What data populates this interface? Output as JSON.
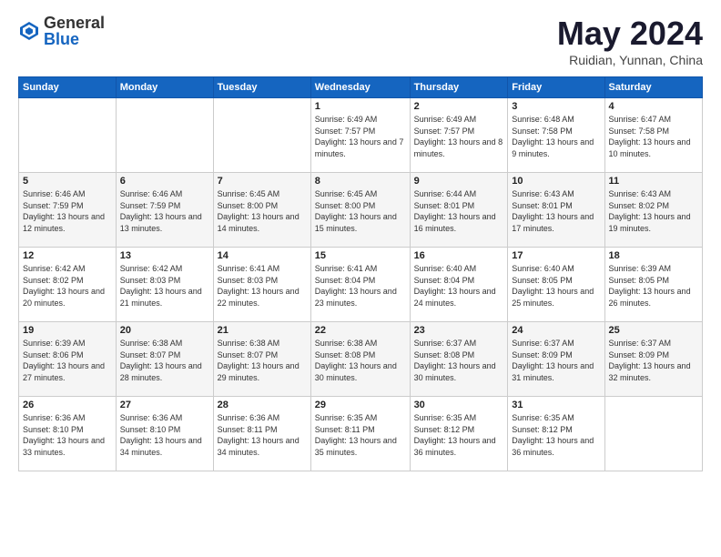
{
  "header": {
    "logo_general": "General",
    "logo_blue": "Blue",
    "month_title": "May 2024",
    "location": "Ruidian, Yunnan, China"
  },
  "weekdays": [
    "Sunday",
    "Monday",
    "Tuesday",
    "Wednesday",
    "Thursday",
    "Friday",
    "Saturday"
  ],
  "weeks": [
    [
      {
        "day": "",
        "sunrise": "",
        "sunset": "",
        "daylight": ""
      },
      {
        "day": "",
        "sunrise": "",
        "sunset": "",
        "daylight": ""
      },
      {
        "day": "",
        "sunrise": "",
        "sunset": "",
        "daylight": ""
      },
      {
        "day": "1",
        "sunrise": "Sunrise: 6:49 AM",
        "sunset": "Sunset: 7:57 PM",
        "daylight": "Daylight: 13 hours and 7 minutes."
      },
      {
        "day": "2",
        "sunrise": "Sunrise: 6:49 AM",
        "sunset": "Sunset: 7:57 PM",
        "daylight": "Daylight: 13 hours and 8 minutes."
      },
      {
        "day": "3",
        "sunrise": "Sunrise: 6:48 AM",
        "sunset": "Sunset: 7:58 PM",
        "daylight": "Daylight: 13 hours and 9 minutes."
      },
      {
        "day": "4",
        "sunrise": "Sunrise: 6:47 AM",
        "sunset": "Sunset: 7:58 PM",
        "daylight": "Daylight: 13 hours and 10 minutes."
      }
    ],
    [
      {
        "day": "5",
        "sunrise": "Sunrise: 6:46 AM",
        "sunset": "Sunset: 7:59 PM",
        "daylight": "Daylight: 13 hours and 12 minutes."
      },
      {
        "day": "6",
        "sunrise": "Sunrise: 6:46 AM",
        "sunset": "Sunset: 7:59 PM",
        "daylight": "Daylight: 13 hours and 13 minutes."
      },
      {
        "day": "7",
        "sunrise": "Sunrise: 6:45 AM",
        "sunset": "Sunset: 8:00 PM",
        "daylight": "Daylight: 13 hours and 14 minutes."
      },
      {
        "day": "8",
        "sunrise": "Sunrise: 6:45 AM",
        "sunset": "Sunset: 8:00 PM",
        "daylight": "Daylight: 13 hours and 15 minutes."
      },
      {
        "day": "9",
        "sunrise": "Sunrise: 6:44 AM",
        "sunset": "Sunset: 8:01 PM",
        "daylight": "Daylight: 13 hours and 16 minutes."
      },
      {
        "day": "10",
        "sunrise": "Sunrise: 6:43 AM",
        "sunset": "Sunset: 8:01 PM",
        "daylight": "Daylight: 13 hours and 17 minutes."
      },
      {
        "day": "11",
        "sunrise": "Sunrise: 6:43 AM",
        "sunset": "Sunset: 8:02 PM",
        "daylight": "Daylight: 13 hours and 19 minutes."
      }
    ],
    [
      {
        "day": "12",
        "sunrise": "Sunrise: 6:42 AM",
        "sunset": "Sunset: 8:02 PM",
        "daylight": "Daylight: 13 hours and 20 minutes."
      },
      {
        "day": "13",
        "sunrise": "Sunrise: 6:42 AM",
        "sunset": "Sunset: 8:03 PM",
        "daylight": "Daylight: 13 hours and 21 minutes."
      },
      {
        "day": "14",
        "sunrise": "Sunrise: 6:41 AM",
        "sunset": "Sunset: 8:03 PM",
        "daylight": "Daylight: 13 hours and 22 minutes."
      },
      {
        "day": "15",
        "sunrise": "Sunrise: 6:41 AM",
        "sunset": "Sunset: 8:04 PM",
        "daylight": "Daylight: 13 hours and 23 minutes."
      },
      {
        "day": "16",
        "sunrise": "Sunrise: 6:40 AM",
        "sunset": "Sunset: 8:04 PM",
        "daylight": "Daylight: 13 hours and 24 minutes."
      },
      {
        "day": "17",
        "sunrise": "Sunrise: 6:40 AM",
        "sunset": "Sunset: 8:05 PM",
        "daylight": "Daylight: 13 hours and 25 minutes."
      },
      {
        "day": "18",
        "sunrise": "Sunrise: 6:39 AM",
        "sunset": "Sunset: 8:05 PM",
        "daylight": "Daylight: 13 hours and 26 minutes."
      }
    ],
    [
      {
        "day": "19",
        "sunrise": "Sunrise: 6:39 AM",
        "sunset": "Sunset: 8:06 PM",
        "daylight": "Daylight: 13 hours and 27 minutes."
      },
      {
        "day": "20",
        "sunrise": "Sunrise: 6:38 AM",
        "sunset": "Sunset: 8:07 PM",
        "daylight": "Daylight: 13 hours and 28 minutes."
      },
      {
        "day": "21",
        "sunrise": "Sunrise: 6:38 AM",
        "sunset": "Sunset: 8:07 PM",
        "daylight": "Daylight: 13 hours and 29 minutes."
      },
      {
        "day": "22",
        "sunrise": "Sunrise: 6:38 AM",
        "sunset": "Sunset: 8:08 PM",
        "daylight": "Daylight: 13 hours and 30 minutes."
      },
      {
        "day": "23",
        "sunrise": "Sunrise: 6:37 AM",
        "sunset": "Sunset: 8:08 PM",
        "daylight": "Daylight: 13 hours and 30 minutes."
      },
      {
        "day": "24",
        "sunrise": "Sunrise: 6:37 AM",
        "sunset": "Sunset: 8:09 PM",
        "daylight": "Daylight: 13 hours and 31 minutes."
      },
      {
        "day": "25",
        "sunrise": "Sunrise: 6:37 AM",
        "sunset": "Sunset: 8:09 PM",
        "daylight": "Daylight: 13 hours and 32 minutes."
      }
    ],
    [
      {
        "day": "26",
        "sunrise": "Sunrise: 6:36 AM",
        "sunset": "Sunset: 8:10 PM",
        "daylight": "Daylight: 13 hours and 33 minutes."
      },
      {
        "day": "27",
        "sunrise": "Sunrise: 6:36 AM",
        "sunset": "Sunset: 8:10 PM",
        "daylight": "Daylight: 13 hours and 34 minutes."
      },
      {
        "day": "28",
        "sunrise": "Sunrise: 6:36 AM",
        "sunset": "Sunset: 8:11 PM",
        "daylight": "Daylight: 13 hours and 34 minutes."
      },
      {
        "day": "29",
        "sunrise": "Sunrise: 6:35 AM",
        "sunset": "Sunset: 8:11 PM",
        "daylight": "Daylight: 13 hours and 35 minutes."
      },
      {
        "day": "30",
        "sunrise": "Sunrise: 6:35 AM",
        "sunset": "Sunset: 8:12 PM",
        "daylight": "Daylight: 13 hours and 36 minutes."
      },
      {
        "day": "31",
        "sunrise": "Sunrise: 6:35 AM",
        "sunset": "Sunset: 8:12 PM",
        "daylight": "Daylight: 13 hours and 36 minutes."
      },
      {
        "day": "",
        "sunrise": "",
        "sunset": "",
        "daylight": ""
      }
    ]
  ]
}
